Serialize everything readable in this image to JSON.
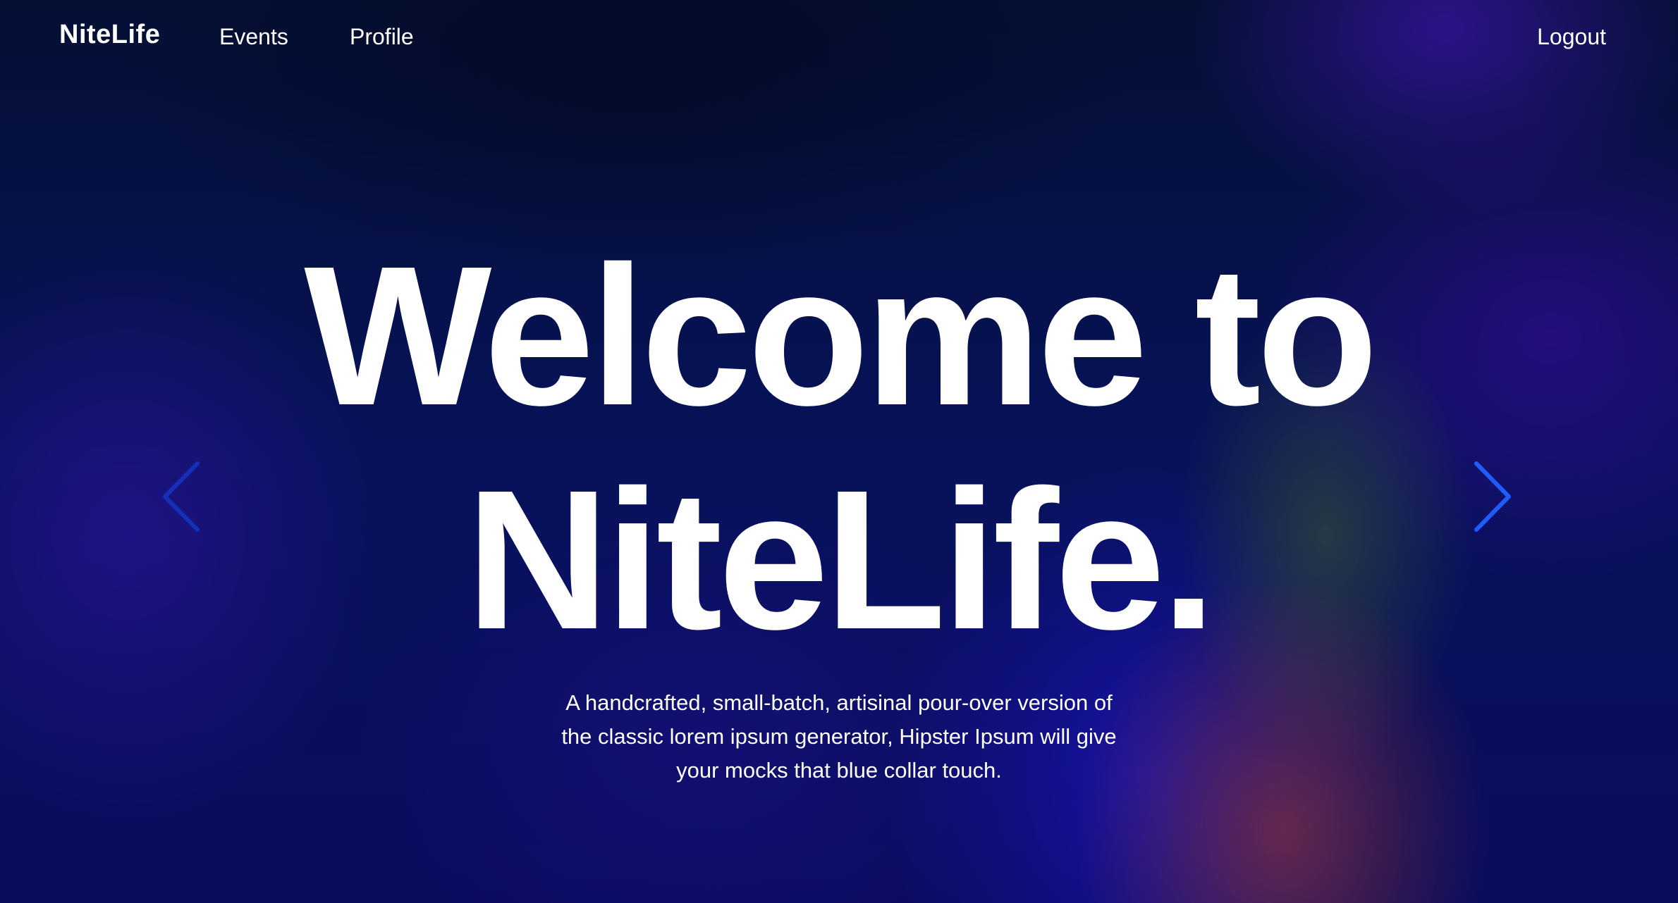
{
  "nav": {
    "brand": "NiteLife",
    "links": [
      "Events",
      "Profile"
    ],
    "logout": "Logout"
  },
  "hero": {
    "headline_line1": "Welcome to",
    "headline_line2": "NiteLife.",
    "subtitle_lines": [
      "A handcrafted, small-batch, artisinal pour-over version of",
      "the classic lorem ipsum generator, Hipster Ipsum will give",
      "your mocks that blue collar touch."
    ]
  },
  "carousel": {
    "prev_icon": "chevron-left-icon",
    "next_icon": "chevron-right-icon",
    "prev_color": "#1530b8",
    "next_color": "#1e5cff"
  }
}
